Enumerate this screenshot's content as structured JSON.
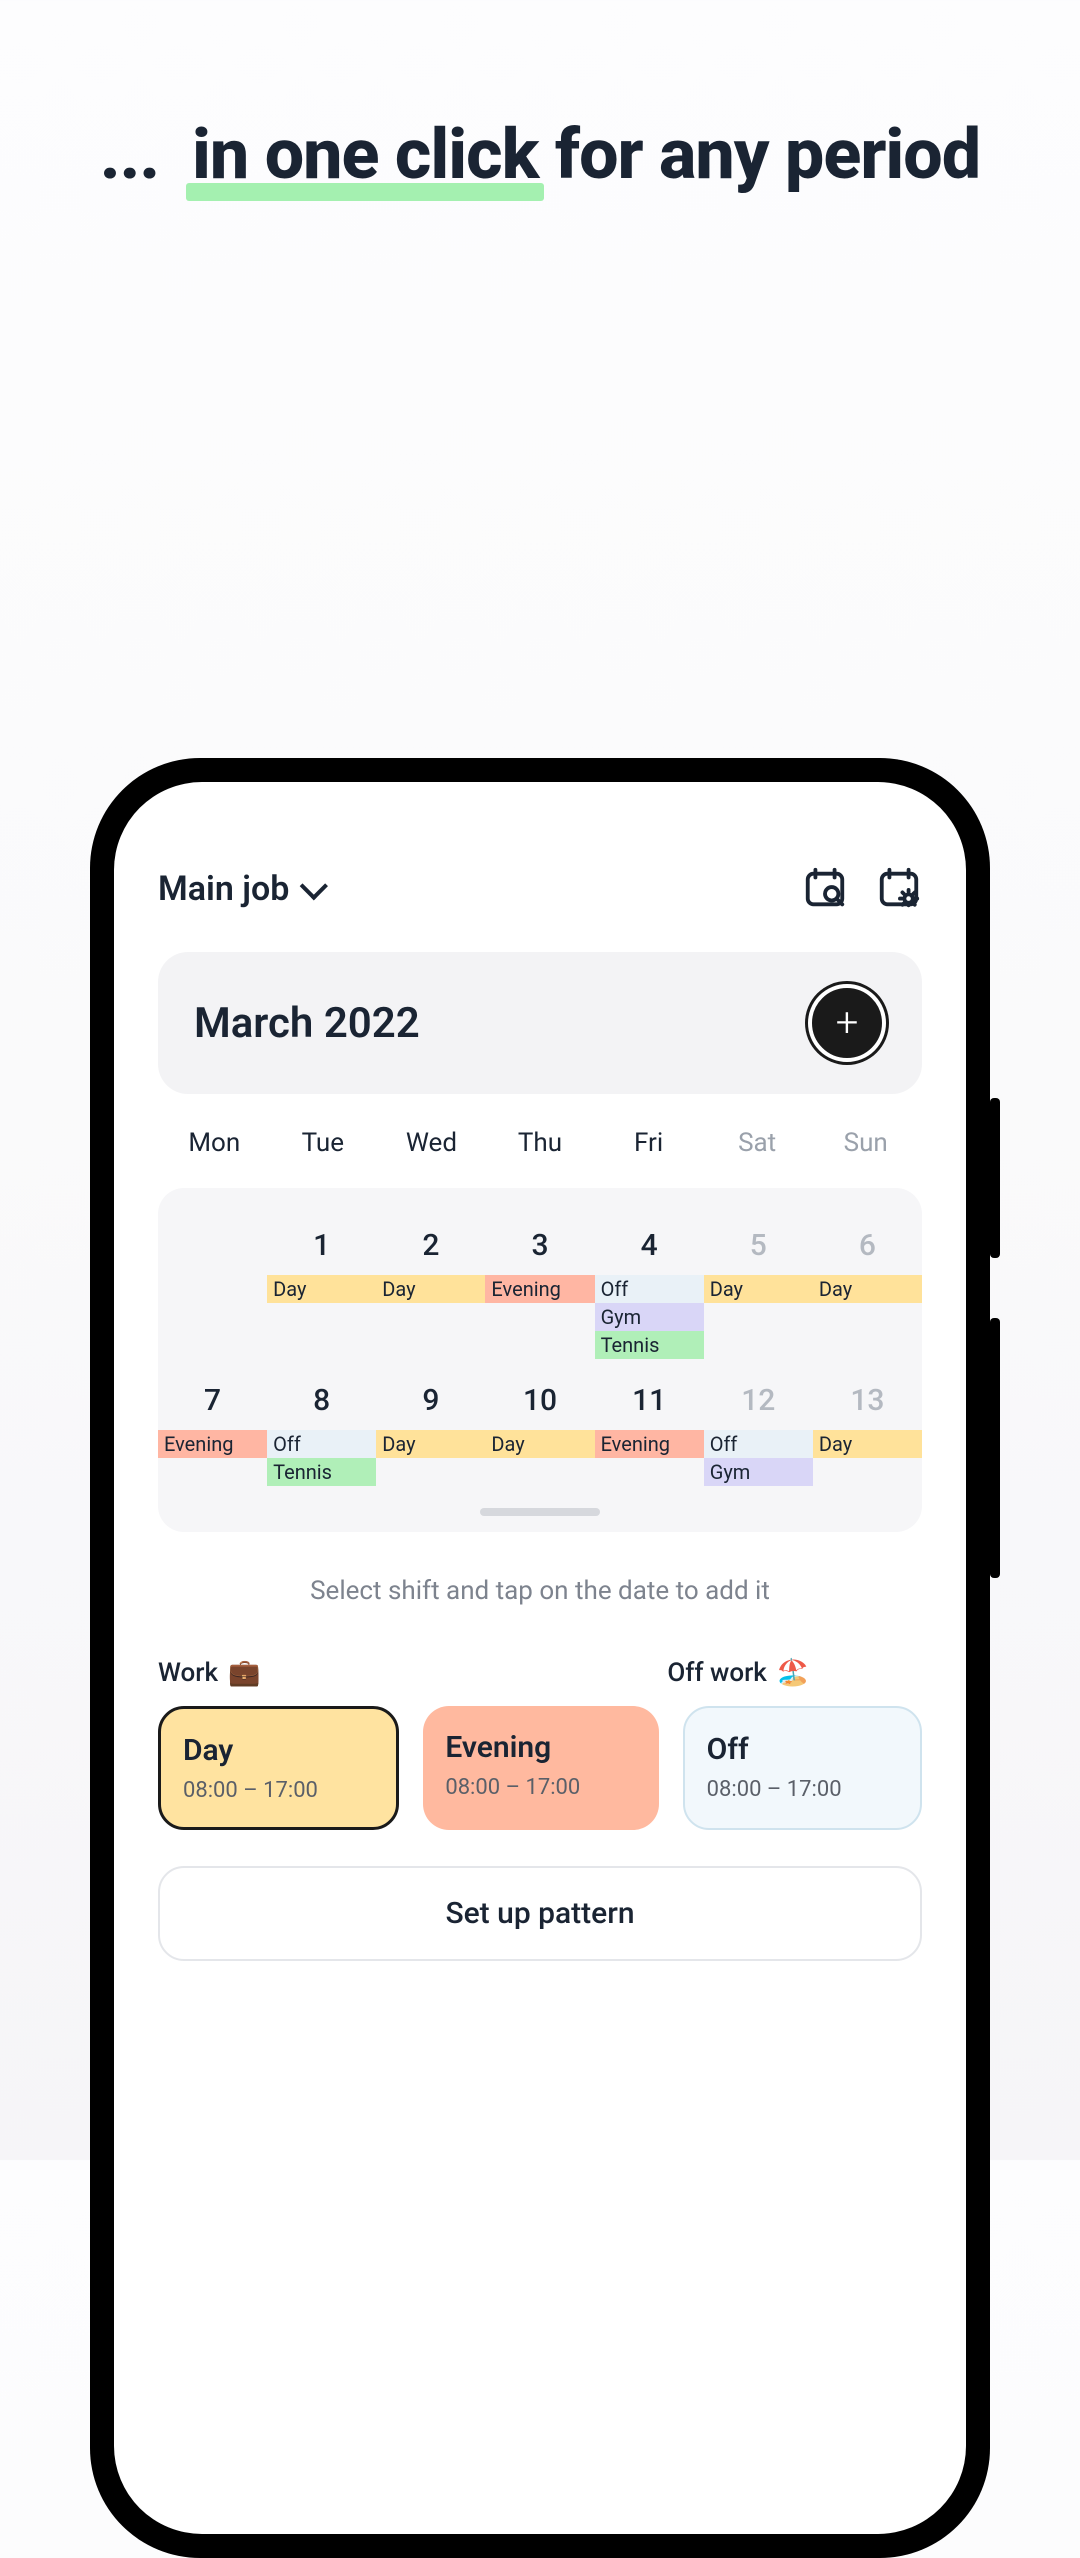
{
  "headline": {
    "prefix": "...",
    "part1": "in one click",
    "part2": "for any period"
  },
  "topbar": {
    "job_label": "Main job"
  },
  "month": {
    "title": "March 2022"
  },
  "weekdays": [
    "Mon",
    "Tue",
    "Wed",
    "Thu",
    "Fri",
    "Sat",
    "Sun"
  ],
  "weeks": [
    {
      "dates": [
        "",
        "1",
        "2",
        "3",
        "4",
        "5",
        "6"
      ],
      "muted": [
        false,
        false,
        false,
        false,
        false,
        true,
        true
      ],
      "chips": [
        [],
        [
          {
            "label": "Day",
            "cls": "c-day"
          }
        ],
        [
          {
            "label": "Day",
            "cls": "c-day"
          }
        ],
        [
          {
            "label": "Evening",
            "cls": "c-eve"
          }
        ],
        [
          {
            "label": "Off",
            "cls": "c-off"
          },
          {
            "label": "Gym",
            "cls": "c-gym"
          },
          {
            "label": "Tennis",
            "cls": "c-tennis"
          }
        ],
        [
          {
            "label": "Day",
            "cls": "c-day"
          }
        ],
        [
          {
            "label": "Day",
            "cls": "c-day"
          }
        ]
      ]
    },
    {
      "dates": [
        "7",
        "8",
        "9",
        "10",
        "11",
        "12",
        "13"
      ],
      "muted": [
        false,
        false,
        false,
        false,
        false,
        true,
        true
      ],
      "chips": [
        [
          {
            "label": "Evening",
            "cls": "c-eve"
          }
        ],
        [
          {
            "label": "Off",
            "cls": "c-off"
          },
          {
            "label": "Tennis",
            "cls": "c-tennis"
          }
        ],
        [
          {
            "label": "Day",
            "cls": "c-day"
          }
        ],
        [
          {
            "label": "Day",
            "cls": "c-day"
          }
        ],
        [
          {
            "label": "Evening",
            "cls": "c-eve"
          }
        ],
        [
          {
            "label": "Off",
            "cls": "c-off"
          },
          {
            "label": "Gym",
            "cls": "c-gym"
          }
        ],
        [
          {
            "label": "Day",
            "cls": "c-day"
          }
        ]
      ]
    }
  ],
  "hint": "Select shift and tap on the date to add it",
  "sections": {
    "work": "Work",
    "off": "Off work"
  },
  "shifts": {
    "day": {
      "name": "Day",
      "time": "08:00 – 17:00"
    },
    "evening": {
      "name": "Evening",
      "time": "08:00 – 17:00"
    },
    "off": {
      "name": "Off",
      "time": "08:00 – 17:00"
    }
  },
  "pattern_btn": "Set up pattern",
  "icons": {
    "briefcase": "💼",
    "beach": "🏖️"
  }
}
